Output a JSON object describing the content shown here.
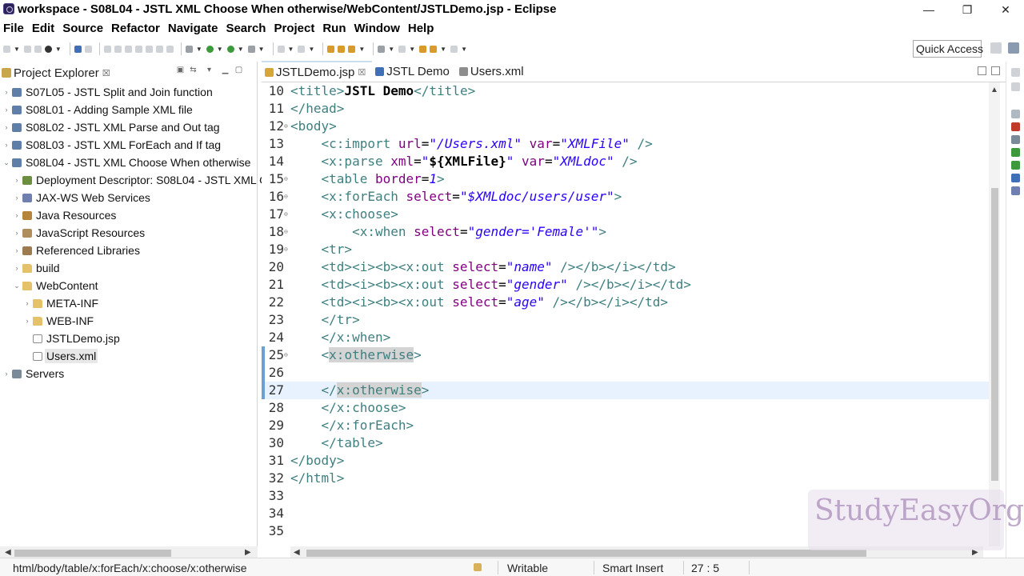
{
  "window": {
    "title": "workspace - S08L04 - JSTL XML Choose When otherwise/WebContent/JSTLDemo.jsp - Eclipse",
    "minimize": "—",
    "restore": "❐",
    "close": "✕"
  },
  "menu": [
    "File",
    "Edit",
    "Source",
    "Refactor",
    "Navigate",
    "Search",
    "Project",
    "Run",
    "Window",
    "Help"
  ],
  "toolbar": {
    "quick_access": "Quick Access"
  },
  "explorer": {
    "title": "Project Explorer",
    "close": "☒",
    "items": [
      {
        "label": "S07L05 - JSTL Split and Join function",
        "icon": "project-icon",
        "level": 0,
        "expanded": false
      },
      {
        "label": "S08L01 - Adding Sample XML file",
        "icon": "project-icon",
        "level": 0,
        "expanded": false
      },
      {
        "label": "S08L02 - JSTL XML Parse and Out tag",
        "icon": "project-icon",
        "level": 0,
        "expanded": false
      },
      {
        "label": "S08L03 - JSTL XML ForEach and If tag",
        "icon": "project-icon",
        "level": 0,
        "expanded": false
      },
      {
        "label": "S08L04 - JSTL XML Choose When otherwise",
        "icon": "project-icon",
        "level": 0,
        "expanded": true
      },
      {
        "label": "Deployment Descriptor: S08L04 - JSTL XML C",
        "icon": "descriptor-icon",
        "level": 1,
        "expanded": false
      },
      {
        "label": "JAX-WS Web Services",
        "icon": "web-services-icon",
        "level": 1,
        "expanded": false
      },
      {
        "label": "Java Resources",
        "icon": "java-resources-icon",
        "level": 1,
        "expanded": false
      },
      {
        "label": "JavaScript Resources",
        "icon": "javascript-resources-icon",
        "level": 1,
        "expanded": false
      },
      {
        "label": "Referenced Libraries",
        "icon": "library-icon",
        "level": 1,
        "expanded": false
      },
      {
        "label": "build",
        "icon": "folder-icon",
        "level": 1,
        "expanded": false
      },
      {
        "label": "WebContent",
        "icon": "folder-icon",
        "level": 1,
        "expanded": true
      },
      {
        "label": "META-INF",
        "icon": "folder-icon",
        "level": 2,
        "expanded": false
      },
      {
        "label": "WEB-INF",
        "icon": "folder-icon",
        "level": 2,
        "expanded": false
      },
      {
        "label": "JSTLDemo.jsp",
        "icon": "file-icon",
        "level": 2,
        "leaf": true
      },
      {
        "label": "Users.xml",
        "icon": "xml-file-icon",
        "level": 2,
        "leaf": true,
        "selected": true
      },
      {
        "label": "Servers",
        "icon": "servers-icon",
        "level": 0,
        "expanded": false
      }
    ]
  },
  "editor": {
    "tabs": [
      {
        "label": "JSTLDemo.jsp",
        "active": true,
        "close": "☒"
      },
      {
        "label": "JSTL Demo",
        "active": false
      },
      {
        "label": "Users.xml",
        "active": false
      }
    ],
    "lines": [
      {
        "n": "10",
        "html": "<span class='tag'>&lt;title&gt;</span><span class='txt-b'><b>JSTL Demo</b></span><span class='tag'>&lt;/title&gt;</span>"
      },
      {
        "n": "11",
        "html": "<span class='tag'>&lt;/head&gt;</span>"
      },
      {
        "n": "12",
        "html": "<span class='tag'>&lt;body&gt;</span>",
        "fold": true
      },
      {
        "n": "13",
        "html": "    <span class='tag'>&lt;c:import</span> <span class='attr'>url</span>=<span class='val'>\"/Users.xml\"</span> <span class='attr'>var</span>=<span class='val'>\"XMLFile\"</span> <span class='tag'>/&gt;</span>"
      },
      {
        "n": "14",
        "html": "    <span class='tag'>&lt;x:parse</span> <span class='attr'>xml</span>=<span class='val'>\"</span><b>${XMLFile}</b><span class='val'>\"</span> <span class='attr'>var</span>=<span class='val'>\"XMLdoc\"</span> <span class='tag'>/&gt;</span>"
      },
      {
        "n": "15",
        "html": "    <span class='tag'>&lt;table</span> <span class='attr'>border</span>=<span class='val'>1</span><span class='tag'>&gt;</span>",
        "fold": true
      },
      {
        "n": "16",
        "html": "    <span class='tag'>&lt;x:forEach</span> <span class='attr'>select</span>=<span class='val'>\"$XMLdoc/users/user\"</span><span class='tag'>&gt;</span>",
        "fold": true
      },
      {
        "n": "17",
        "html": "    <span class='tag'>&lt;x:choose&gt;</span>",
        "fold": true
      },
      {
        "n": "18",
        "html": "        <span class='tag'>&lt;x:when</span> <span class='attr'>select</span>=<span class='val'>\"gender='Female'\"</span><span class='tag'>&gt;</span>",
        "fold": true
      },
      {
        "n": "19",
        "html": "    <span class='tag'>&lt;tr&gt;</span>",
        "fold": true
      },
      {
        "n": "20",
        "html": "    <span class='tag'>&lt;td&gt;&lt;i&gt;&lt;b&gt;&lt;x:out</span> <span class='attr'>select</span>=<span class='val'>\"name\"</span> <span class='tag'>/&gt;&lt;/b&gt;&lt;/i&gt;&lt;/td&gt;</span>"
      },
      {
        "n": "21",
        "html": "    <span class='tag'>&lt;td&gt;&lt;i&gt;&lt;b&gt;&lt;x:out</span> <span class='attr'>select</span>=<span class='val'>\"gender\"</span> <span class='tag'>/&gt;&lt;/b&gt;&lt;/i&gt;&lt;/td&gt;</span>"
      },
      {
        "n": "22",
        "html": "    <span class='tag'>&lt;td&gt;&lt;i&gt;&lt;b&gt;&lt;x:out</span> <span class='attr'>select</span>=<span class='val'>\"age\"</span> <span class='tag'>/&gt;&lt;/b&gt;&lt;/i&gt;&lt;/td&gt;</span>"
      },
      {
        "n": "23",
        "html": "    <span class='tag'>&lt;/tr&gt;</span>"
      },
      {
        "n": "24",
        "html": "    <span class='tag'>&lt;/x:when&gt;</span>"
      },
      {
        "n": "25",
        "html": "    <span class='tag'>&lt;<span class='hl'>x:otherwise</span>&gt;</span>",
        "fold": true,
        "changed": true
      },
      {
        "n": "26",
        "html": "",
        "changed": true
      },
      {
        "n": "27",
        "html": "    <span class='tag'>&lt;/<span class='hl'>x:otherwise</span>&gt;</span>",
        "current": true,
        "changed": true
      },
      {
        "n": "28",
        "html": "    <span class='tag'>&lt;/x:choose&gt;</span>"
      },
      {
        "n": "29",
        "html": "    <span class='tag'>&lt;/x:forEach&gt;</span>"
      },
      {
        "n": "30",
        "html": "    <span class='tag'>&lt;/table&gt;</span>"
      },
      {
        "n": "31",
        "html": "<span class='tag'>&lt;/body&gt;</span>"
      },
      {
        "n": "32",
        "html": "<span class='tag'>&lt;/html&gt;</span>"
      },
      {
        "n": "33",
        "html": ""
      },
      {
        "n": "34",
        "html": ""
      },
      {
        "n": "35",
        "html": ""
      }
    ]
  },
  "watermark": {
    "brand": "StudyEasyOrg"
  },
  "status": {
    "path": "html/body/table/x:forEach/x:choose/x:otherwise",
    "mode": "Writable",
    "insert": "Smart Insert",
    "position": "27 : 5"
  }
}
